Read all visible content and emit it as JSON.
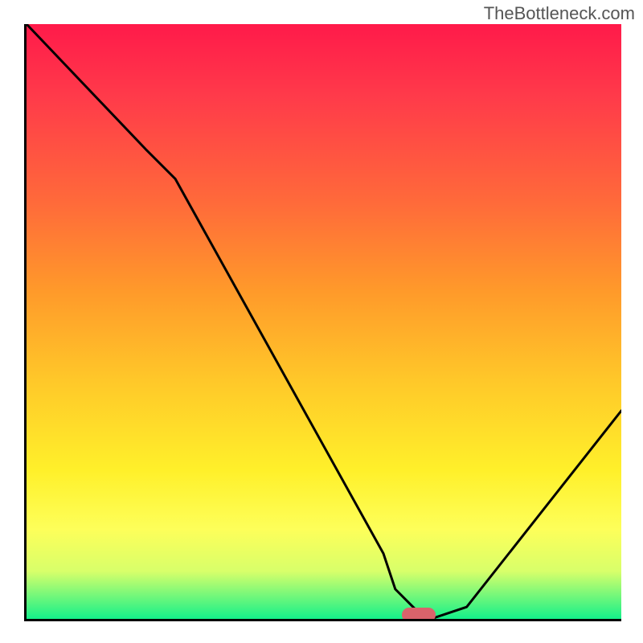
{
  "watermark": "TheBottleneck.com",
  "chart_data": {
    "type": "line",
    "title": "",
    "xlabel": "",
    "ylabel": "",
    "xlim": [
      0,
      100
    ],
    "ylim": [
      0,
      100
    ],
    "series": [
      {
        "name": "curve",
        "x": [
          0,
          20,
          25,
          60,
          62,
          67,
          68,
          74,
          100
        ],
        "values": [
          100,
          79,
          74,
          11,
          5,
          0,
          0,
          2,
          35
        ]
      }
    ],
    "marker": {
      "x": 66,
      "y": 0
    },
    "gradient_colors": {
      "top": "#ff1a4a",
      "mid": "#fff02a",
      "bottom": "#14f08a"
    }
  }
}
